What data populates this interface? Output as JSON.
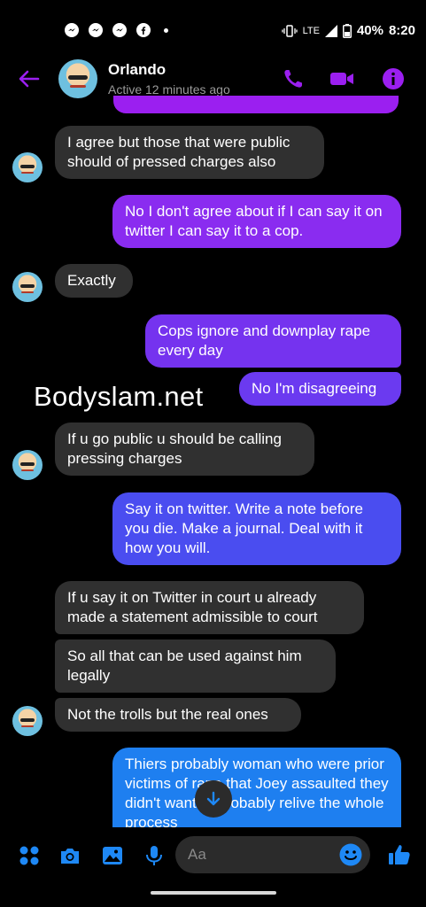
{
  "status_bar": {
    "time": "8:20",
    "battery": "40%",
    "network": "LTE"
  },
  "header": {
    "contact_name": "Orlando",
    "active_status": "Active 12 minutes ago"
  },
  "watermark": "Bodyslam.net",
  "messages": [
    {
      "direction": "incoming",
      "text": "I agree but those that were public should of pressed charges also"
    },
    {
      "direction": "outgoing",
      "text": "No I don't agree about if I can say it on twitter I can say it to a cop."
    },
    {
      "direction": "incoming",
      "text": "Exactly"
    },
    {
      "direction": "outgoing",
      "text": "Cops ignore and downplay rape every day"
    },
    {
      "direction": "outgoing",
      "text": "No I'm disagreeing"
    },
    {
      "direction": "incoming",
      "text": "If u go public u should be calling pressing charges"
    },
    {
      "direction": "outgoing",
      "text": "Say it on twitter. Write a note before you die. Make a journal. Deal with it how you will."
    },
    {
      "direction": "incoming",
      "text": "If u say it on Twitter in court u already made a statement admissible to court"
    },
    {
      "direction": "incoming",
      "text": "So all that can be used against him legally"
    },
    {
      "direction": "incoming",
      "text": "Not the trolls but the real ones"
    },
    {
      "direction": "outgoing",
      "text": "Thiers probably woman who were prior victims of rape that Joey assaulted they didn't want to probably relive the whole process"
    }
  ],
  "composer": {
    "placeholder": "Aa"
  },
  "colors": {
    "accent_purple": "#9b1ff0",
    "bubble_incoming": "#303030",
    "icon_blue": "#1e88f5"
  }
}
